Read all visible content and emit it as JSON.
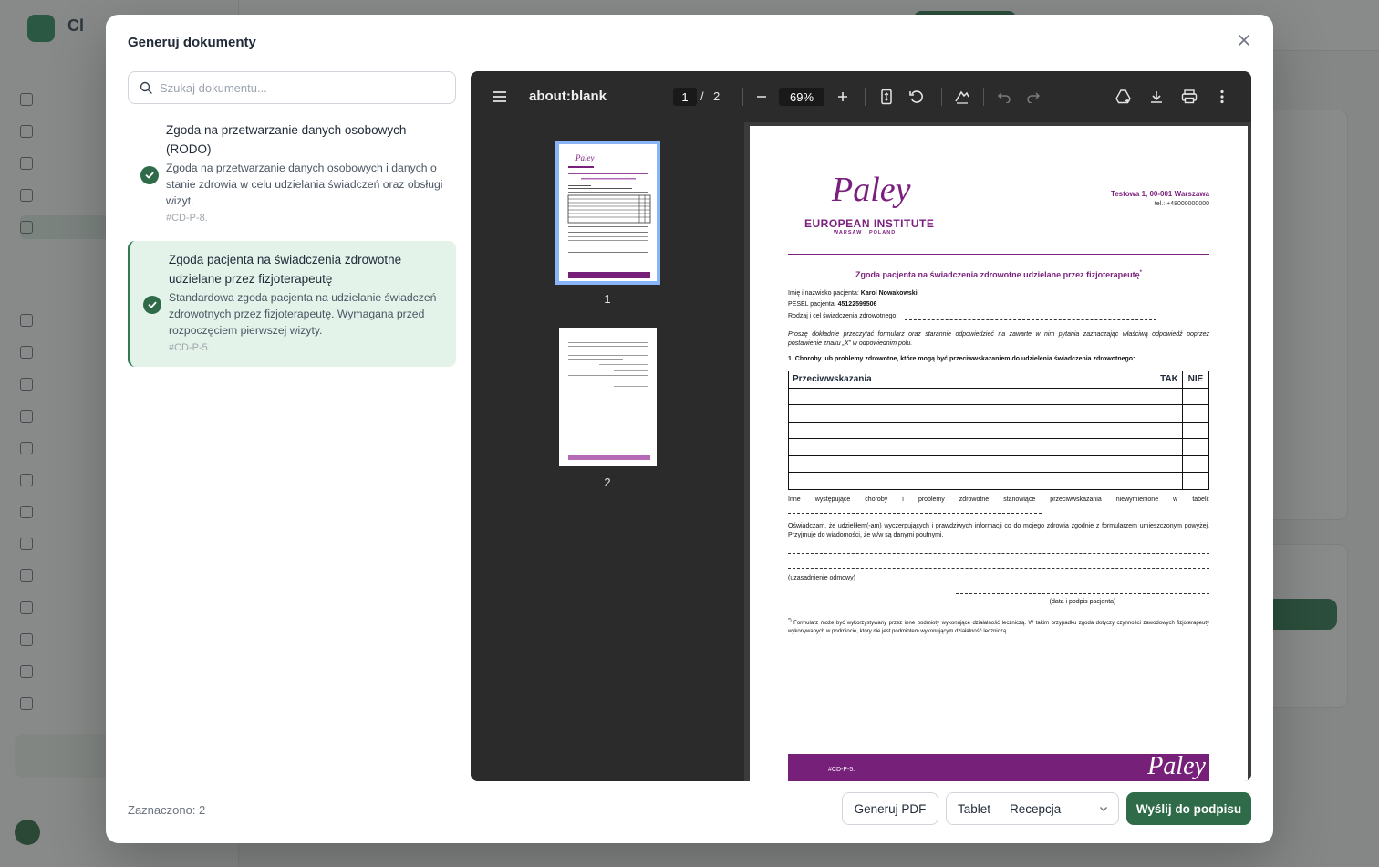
{
  "modal": {
    "title": "Generuj dokumenty",
    "search_placeholder": "Szukaj dokumentu...",
    "documents": [
      {
        "title": "Zgoda na przetwarzanie danych osobowych (RODO)",
        "description": "Zgoda na przetwarzanie danych osobowych i danych o stanie zdrowia w celu udzielania świadczeń oraz obsługi wizyt.",
        "code": "#CD-P-8.",
        "checked": true
      },
      {
        "title": "Zgoda pacjenta na świadczenia zdrowotne udzielane przez fizjoterapeutę",
        "description": "Standardowa zgoda pacjenta na udzielanie świadczeń zdrowotnych przez fizjoterapeutę. Wymagana przed rozpoczęciem pierwszej wizyty.",
        "code": "#CD-P-5.",
        "checked": true,
        "selected": true
      }
    ],
    "footer": {
      "selected_count": "Zaznaczono: 2",
      "generate_pdf": "Generuj PDF",
      "device_select": "Tablet — Recepcja",
      "send_for_signature": "Wyślij do podpisu"
    }
  },
  "viewer": {
    "title": "about:blank",
    "current_page": "1",
    "page_separator": "/",
    "total_pages": "2",
    "zoom": "69%",
    "thumbnails": [
      "1",
      "2"
    ]
  },
  "pdf_page": {
    "logo_script": "Paley",
    "logo_name": "EUROPEAN INSTITUTE",
    "logo_sub": "WARSAW   POLAND",
    "address": "Testowa 1, 00-001 Warszawa",
    "phone": "tel.: +48000000000",
    "heading": "Zgoda pacjenta na świadczenia zdrowotne udzielane przez fizjoterapeutę",
    "heading_mark": "*",
    "patient_name_label": "Imię i nazwisko pacjenta:",
    "patient_name": "Karol Nowakowski",
    "pesel_label": "PESEL pacjenta:",
    "pesel": "45122599506",
    "service_label": "Rodzaj i cel świadczenia zdrowotnego:",
    "instructions": "Proszę dokładnie przeczytać formularz oraz starannie odpowiedzieć na zawarte w nim pytania zaznaczając właściwą odpowiedź poprzez postawienie znaku „X” w odpowiednim polu.",
    "section1": "1. Choroby lub problemy zdrowotne, które mogą być przeciwwskazaniem do udzielenia świadczenia zdrowotnego:",
    "table_headers": [
      "Przeciwwskazania",
      "TAK",
      "NIE"
    ],
    "other_conditions": "Inne występujące choroby i problemy zdrowotne stanowiące przeciwwskazania niewymienione w tabeli:",
    "declaration": "Oświadczam, że udzieliłem(-am) wyczerpujących i prawdziwych informacji co do mojego zdrowia zgodnie z formularzem umieszczonym powyżej. Przyjmuję do wiadomości, że w/w są danymi poufnymi.",
    "refusal_reason": "(uzasadnienie odmowy)",
    "signature_label": "(data i podpis pacjenta)",
    "footnote_mark": "*)",
    "footnote": "Formularz może być wykorzystywany przez inne podmioty wykonujące działalność leczniczą. W takim przypadku zgoda dotyczy czynności zawodowych fizjoterapeuty wykonywanych w podmiocie, który nie jest podmiotem wykonującym działalność leczniczą.",
    "footer_code": "#CD-P-5.",
    "footer_logo": "Paley"
  },
  "colors": {
    "primary": "#2f6b48",
    "selected_bg": "#e3f3e9",
    "brand_purple": "#76207a",
    "viewer_dark": "#2b2b2b"
  }
}
